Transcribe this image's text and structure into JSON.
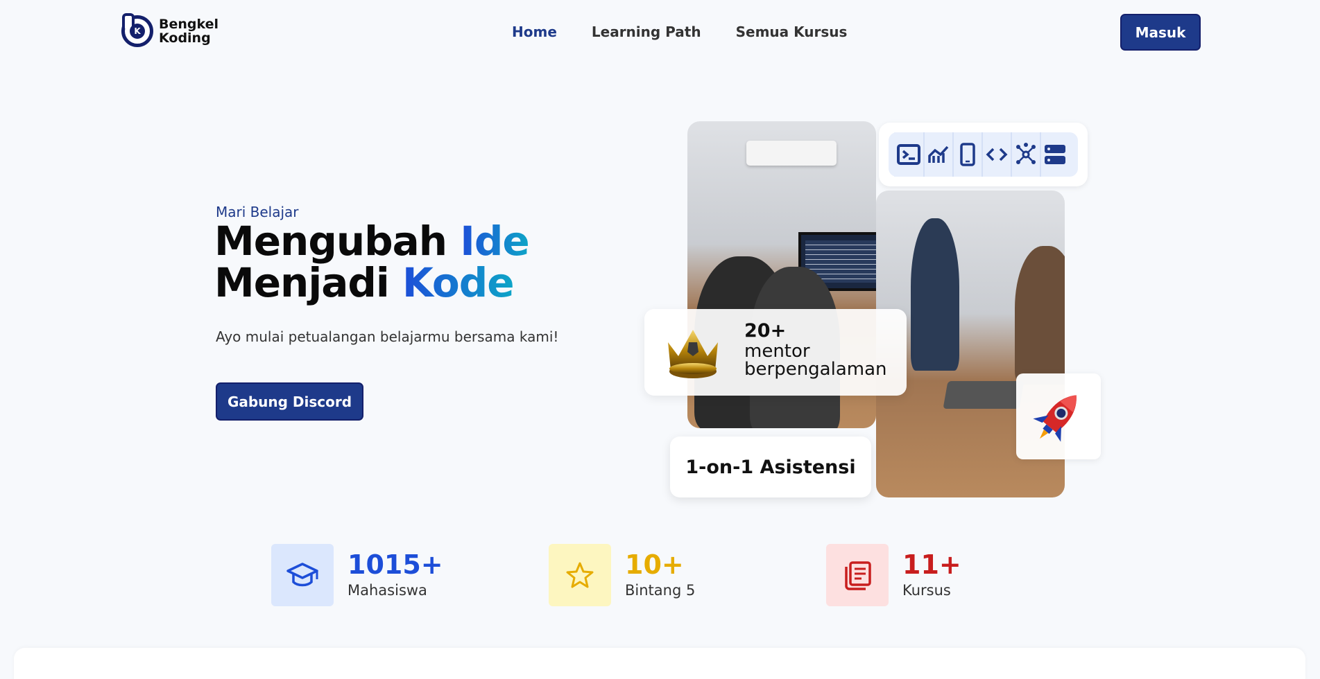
{
  "brand": {
    "name_line1": "Bengkel",
    "name_line2": "Koding",
    "mark_letter": "K"
  },
  "nav": {
    "links": [
      {
        "label": "Home",
        "active": true
      },
      {
        "label": "Learning Path",
        "active": false
      },
      {
        "label": "Semua Kursus",
        "active": false
      }
    ],
    "login_label": "Masuk"
  },
  "hero": {
    "pretitle": "Mari Belajar",
    "title_line1_plain": "Mengubah ",
    "title_line1_accent": "Ide",
    "title_line2_plain": "Menjadi ",
    "title_line2_accent": "Kode",
    "subtitle": "Ayo mulai petualangan belajarmu bersama kami!",
    "cta_label": "Gabung Discord"
  },
  "tech_icons": [
    "terminal-icon",
    "chart-icon",
    "mobile-icon",
    "code-icon",
    "network-icon",
    "server-icon"
  ],
  "mentor_card": {
    "count": "20+",
    "label": "mentor berpengalaman"
  },
  "asistensi_card": {
    "label": "1-on-1 Asistensi"
  },
  "stats": [
    {
      "value": "1015+",
      "label": "Mahasiswa",
      "icon": "graduation-cap-icon",
      "color": "#1d4ed8",
      "bg": "#dbe7fd"
    },
    {
      "value": "10+",
      "label": "Bintang 5",
      "icon": "star-icon",
      "color": "#e6ac00",
      "bg": "#fdf6c0"
    },
    {
      "value": "11+",
      "label": "Kursus",
      "icon": "book-icon",
      "color": "#c81e1e",
      "bg": "#fde0e0"
    }
  ],
  "colors": {
    "primary": "#1e3a8a",
    "accent_gradient_start": "#1d4ed8",
    "accent_gradient_end": "#0ea5c7",
    "background": "#f7f9fc"
  }
}
